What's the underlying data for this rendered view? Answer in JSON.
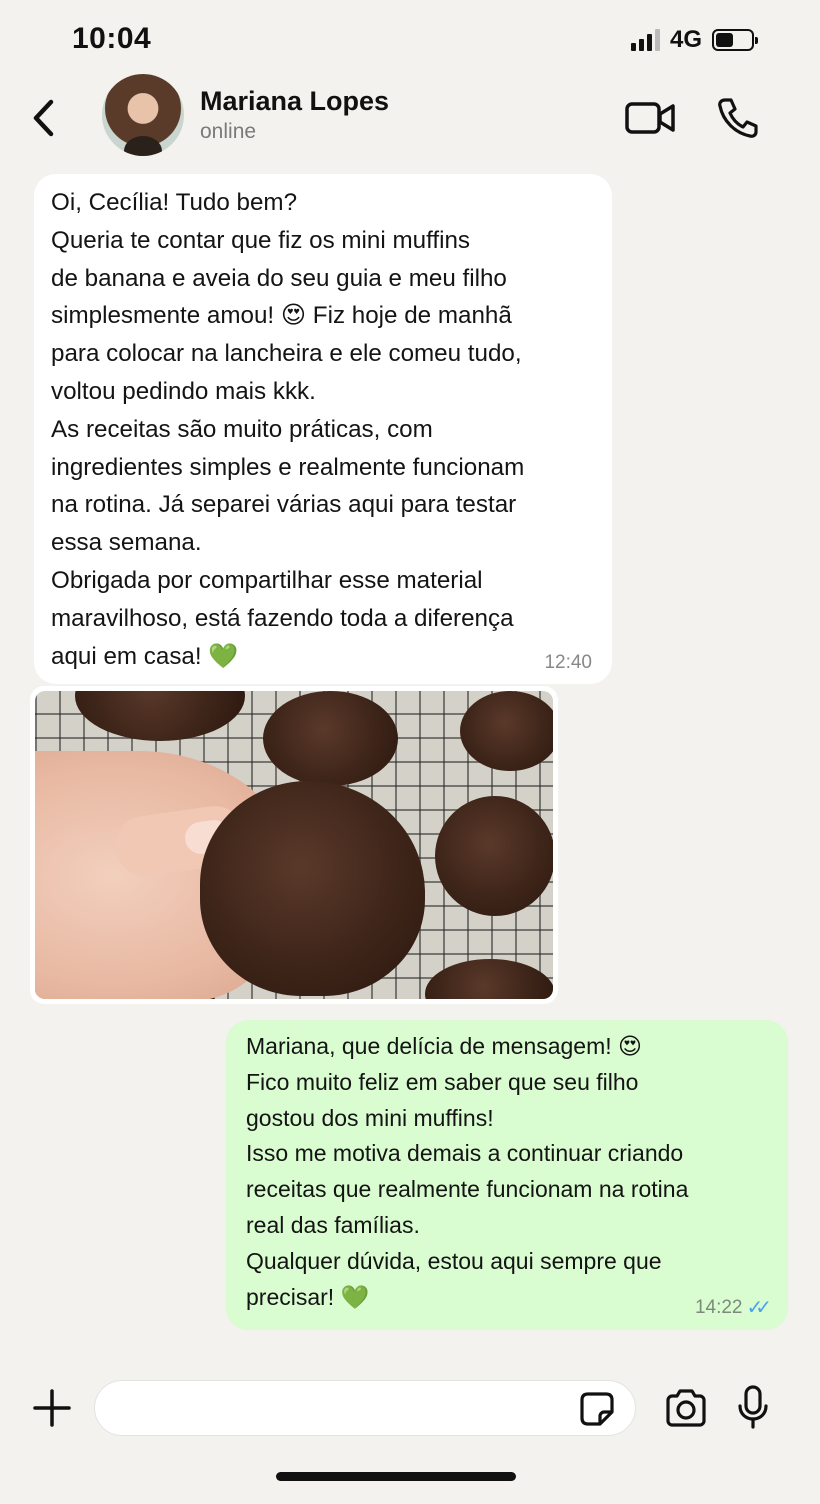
{
  "status_bar": {
    "time": "10:04",
    "network": "4G",
    "signal_bars": 3,
    "battery_level": 0.5
  },
  "header": {
    "contact_name": "Mariana Lopes",
    "contact_status": "online",
    "icons": [
      "chevron-left-icon",
      "video-camera-icon",
      "phone-icon"
    ]
  },
  "messages": [
    {
      "direction": "incoming",
      "text": "Oi, Cecília! Tudo bem?\nQueria te contar que fiz os mini muffins\nde banana e aveia do seu guia e meu filho\nsimplesmente amou! 😍 Fiz hoje de manhã\npara colocar na lancheira e ele comeu tudo,\nvoltou pedindo mais kkk.\nAs receitas são muito práticas, com\ningredientes simples e realmente funcionam\nna rotina. Já separei várias aqui para testar\nessa semana.\nObrigada por compartilhar esse material\nmaravilhoso, está fazendo toda a diferença\naqui em casa! 💚",
      "time": "12:40"
    },
    {
      "direction": "incoming",
      "type": "image",
      "image_description": "photo-muffins"
    },
    {
      "direction": "outgoing",
      "text": "Mariana, que delícia de mensagem! 😍\nFico muito feliz em saber que seu filho\ngostou dos mini muffins!\nIsso me motiva demais a continuar criando\nreceitas que realmente funcionam na rotina\nreal das famílias.\nQualquer dúvida, estou aqui sempre que\nprecisar! 💚",
      "time": "14:22",
      "read_ticks": "✓✓"
    }
  ],
  "composer": {
    "input_value": "",
    "icons": [
      "plus-icon",
      "sticker-icon",
      "camera-icon",
      "microphone-icon"
    ]
  },
  "colors": {
    "background": "#f3f2ee",
    "incoming_bubble": "#ffffff",
    "outgoing_bubble": "#d9fcd0",
    "read_ticks": "#4aa3ef"
  }
}
